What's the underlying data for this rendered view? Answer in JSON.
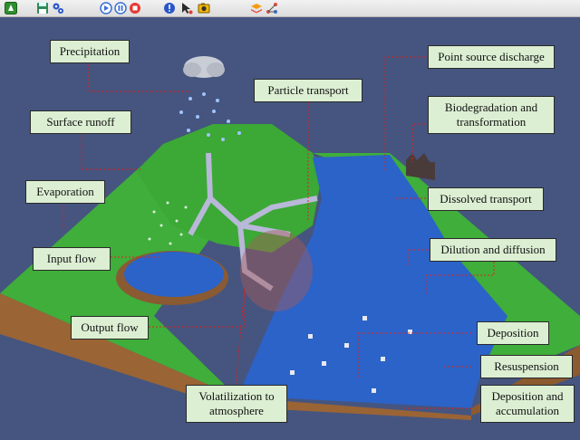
{
  "toolbar": {
    "icons": [
      "app-logo-icon",
      "save-icon",
      "settings-gears-icon",
      "replay-icon",
      "pause-icon",
      "stop-icon",
      "info-icon",
      "cursor-icon",
      "camera-icon",
      "layers-icon",
      "network-icon"
    ]
  },
  "labels": {
    "precipitation": "Precipitation",
    "particle_transport": "Particle transport",
    "point_source_discharge": "Point source discharge",
    "surface_runoff": "Surface runoff",
    "biodegradation": "Biodegradation and transformation",
    "evaporation": "Evaporation",
    "dissolved_transport": "Dissolved transport",
    "input_flow": "Input flow",
    "dilution_diffusion": "Dilution and diffusion",
    "output_flow": "Output flow",
    "deposition": "Deposition",
    "resuspension": "Resuspension",
    "volatilization": "Volatilization to atmosphere",
    "deposition_accumulation": "Deposition and accumulation"
  },
  "colors": {
    "background": "#45557f",
    "land": "#3fae3a",
    "water": "#2b63c8",
    "soil": "#a0683a",
    "label_fill": "#dcefd3",
    "leader_line": "#e0201c"
  }
}
